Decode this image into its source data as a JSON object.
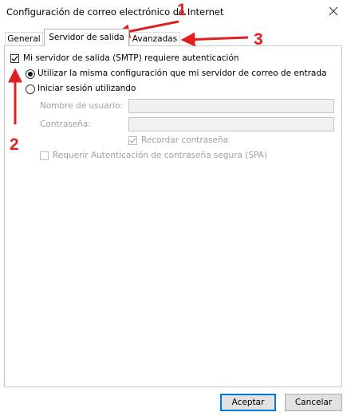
{
  "window": {
    "title": "Configuración de correo electrónico de Internet",
    "close_glyph": "✕"
  },
  "tabs": [
    {
      "label": "General",
      "active": false
    },
    {
      "label": "Servidor de salida",
      "active": true
    },
    {
      "label": "Avanzadas",
      "active": false
    }
  ],
  "smtp": {
    "requires_auth_label": "Mi servidor de salida (SMTP) requiere autenticación",
    "requires_auth_checked": true,
    "same_settings_label": "Utilizar la misma configuración que mi servidor de correo de entrada",
    "same_settings_selected": true,
    "login_using_label": "Iniciar sesión utilizando",
    "login_using_selected": false,
    "username_label": "Nombre de usuario:",
    "username_value": "",
    "password_label": "Contraseña:",
    "password_value": "",
    "remember_password_label": "Recordar contraseña",
    "remember_password_checked": true,
    "spa_label": "Requerir Autenticación de contraseña segura (SPA)",
    "spa_checked": false
  },
  "buttons": {
    "ok": "Aceptar",
    "cancel": "Cancelar"
  },
  "annotations": {
    "numbers": [
      "1",
      "2",
      "3"
    ],
    "color": "#e02020"
  }
}
